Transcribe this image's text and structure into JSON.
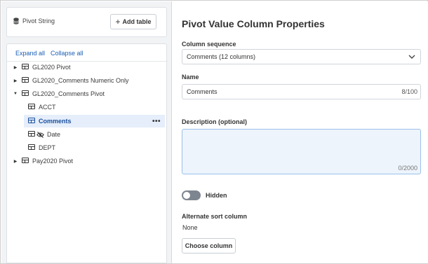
{
  "source": {
    "label": "Pivot String",
    "icon": "database-icon"
  },
  "toolbar": {
    "add_table_label": "Add table"
  },
  "tree": {
    "expand_all": "Expand all",
    "collapse_all": "Collapse all",
    "tables": [
      {
        "name": "GL2020 Pivot",
        "expanded": false
      },
      {
        "name": "GL2020_Comments Numeric Only",
        "expanded": false
      },
      {
        "name": "GL2020_Comments Pivot",
        "expanded": true,
        "columns": [
          {
            "name": "ACCT",
            "selected": false,
            "hidden": false
          },
          {
            "name": "Comments",
            "selected": true,
            "hidden": false
          },
          {
            "name": "Date",
            "selected": false,
            "hidden": true
          },
          {
            "name": "DEPT",
            "selected": false,
            "hidden": false
          }
        ]
      },
      {
        "name": "Pay2020 Pivot",
        "expanded": false
      }
    ],
    "more_menu": "•••"
  },
  "properties": {
    "title": "Pivot Value Column Properties",
    "column_sequence_label": "Column sequence",
    "column_sequence_value": "Comments (12 columns)",
    "name_label": "Name",
    "name_value": "Comments",
    "name_counter": "8/100",
    "description_label": "Description (optional)",
    "description_value": "",
    "description_counter": "0/2000",
    "hidden_label": "Hidden",
    "hidden_on": false,
    "alt_sort_label": "Alternate sort column",
    "alt_sort_value": "None",
    "choose_column_label": "Choose column"
  },
  "colors": {
    "accent": "#1a5fb4",
    "selected_bg": "#e5eefa",
    "toggle_off": "#7d8590"
  }
}
